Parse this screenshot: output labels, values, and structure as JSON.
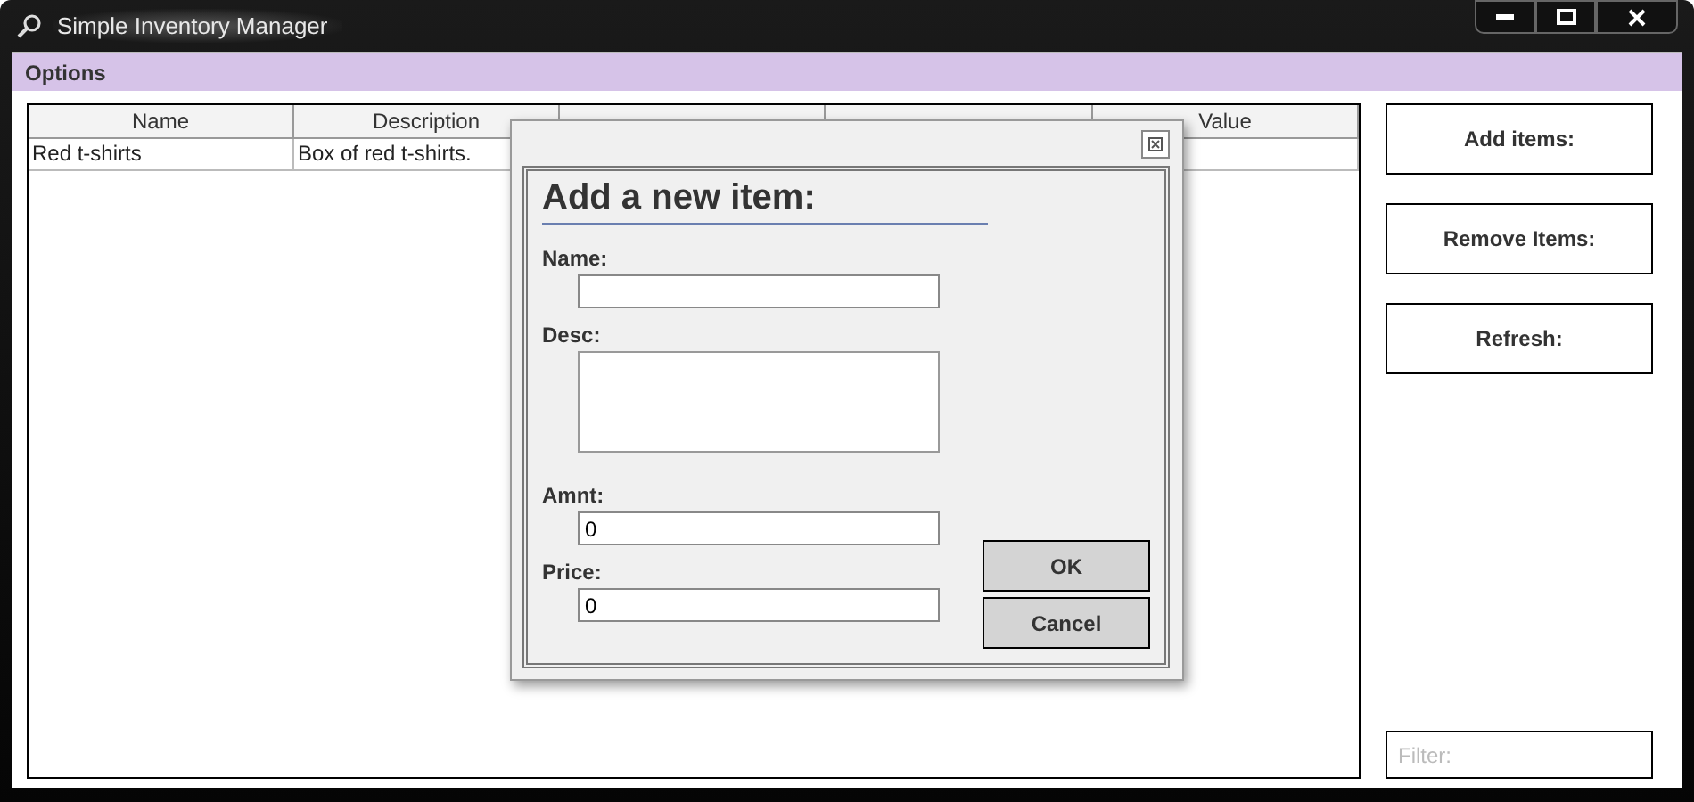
{
  "window": {
    "title": "Simple Inventory Manager"
  },
  "menu_bar": {
    "items": [
      "Options"
    ]
  },
  "table": {
    "columns": [
      {
        "label": "Name"
      },
      {
        "label": "Description"
      },
      {},
      {},
      {
        "label": "Value"
      }
    ],
    "rows": [
      [
        "Red t-shirts",
        "Box of red t-shirts.",
        "",
        "",
        ""
      ]
    ]
  },
  "side_buttons": [
    "Add items:",
    "Remove Items:",
    "Refresh:"
  ],
  "filter": {
    "placeholder": "Filter:"
  },
  "dialog": {
    "heading": "Add a new item:",
    "fields": [
      {
        "label": "Name:",
        "kind": "line"
      },
      {
        "label": "Desc:",
        "kind": "area"
      },
      {
        "label": "Amnt:",
        "kind": "line",
        "value": "0"
      },
      {
        "label": "Price:",
        "kind": "line",
        "value": "0"
      }
    ],
    "buttons": [
      "OK",
      "Cancel"
    ]
  }
}
